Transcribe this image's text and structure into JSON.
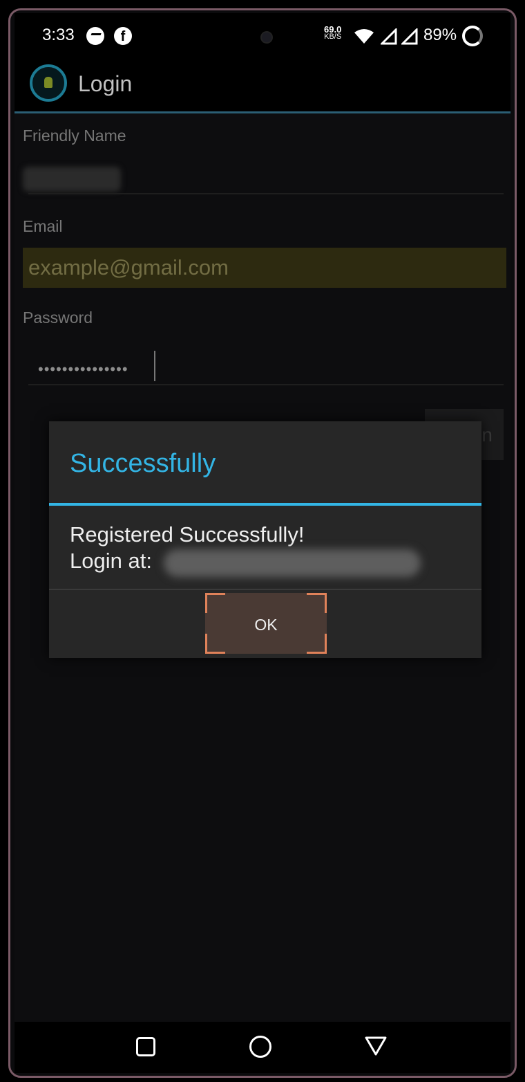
{
  "status_bar": {
    "time": "3:33",
    "net_speed_value": "69.0",
    "net_speed_unit": "KB/S",
    "battery": "89%",
    "icons": [
      "messenger-icon",
      "facebook-icon",
      "wifi-icon",
      "signal-icon",
      "signal-icon",
      "battery-saver-icon"
    ]
  },
  "app_bar": {
    "title": "Login",
    "icon": "android-app-icon"
  },
  "form": {
    "friendly_name_label": "Friendly Name",
    "email_label": "Email",
    "email_placeholder": "example@gmail.com",
    "password_label": "Password",
    "password_value": "•••••••••••••••",
    "login_button_label": "n"
  },
  "dialog": {
    "title": "Successfully",
    "message_line1": "Registered Successfully!",
    "message_line2": "Login at:",
    "ok_label": "OK"
  },
  "nav_bar": {
    "icons": [
      "recent-apps-icon",
      "home-icon",
      "back-icon"
    ]
  },
  "colors": {
    "accent": "#33b5e5",
    "focus": "#e0825a"
  }
}
